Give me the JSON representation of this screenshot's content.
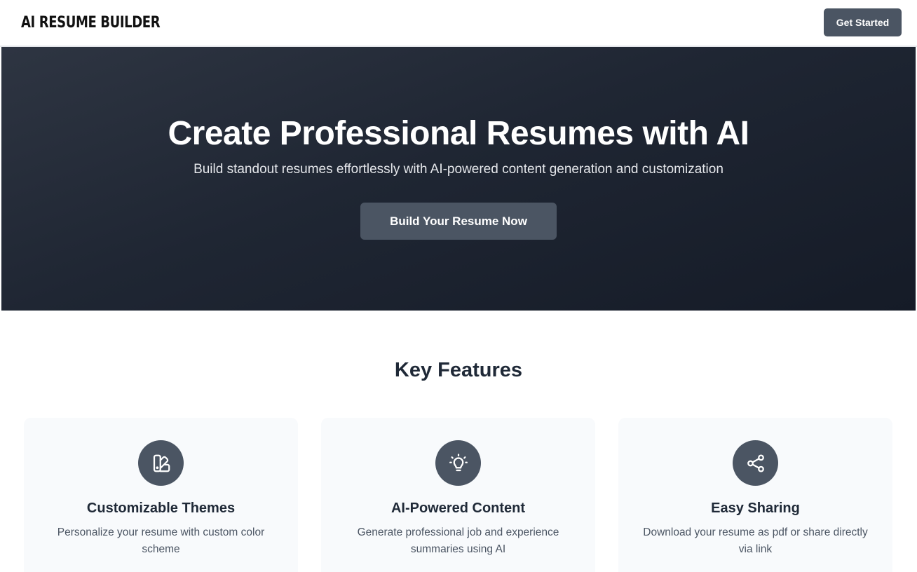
{
  "header": {
    "logo_text": "AI RESUME BUILDER",
    "get_started_label": "Get Started"
  },
  "hero": {
    "title": "Create Professional Resumes with AI",
    "subtitle": "Build standout resumes effortlessly with AI-powered content generation and customization",
    "cta_label": "Build Your Resume Now"
  },
  "features": {
    "title": "Key Features",
    "items": [
      {
        "icon": "palette-swatch-icon",
        "title": "Customizable Themes",
        "description": "Personalize your resume with custom color scheme"
      },
      {
        "icon": "lightbulb-icon",
        "title": "AI-Powered Content",
        "description": "Generate professional job and experience summaries using AI"
      },
      {
        "icon": "share-icon",
        "title": "Easy Sharing",
        "description": "Download your resume as pdf or share directly via link"
      }
    ]
  },
  "colors": {
    "accent": "#4b5563",
    "hero_bg": "#1f2633",
    "card_bg": "#f8fafc",
    "text_dark": "#1f2937"
  }
}
